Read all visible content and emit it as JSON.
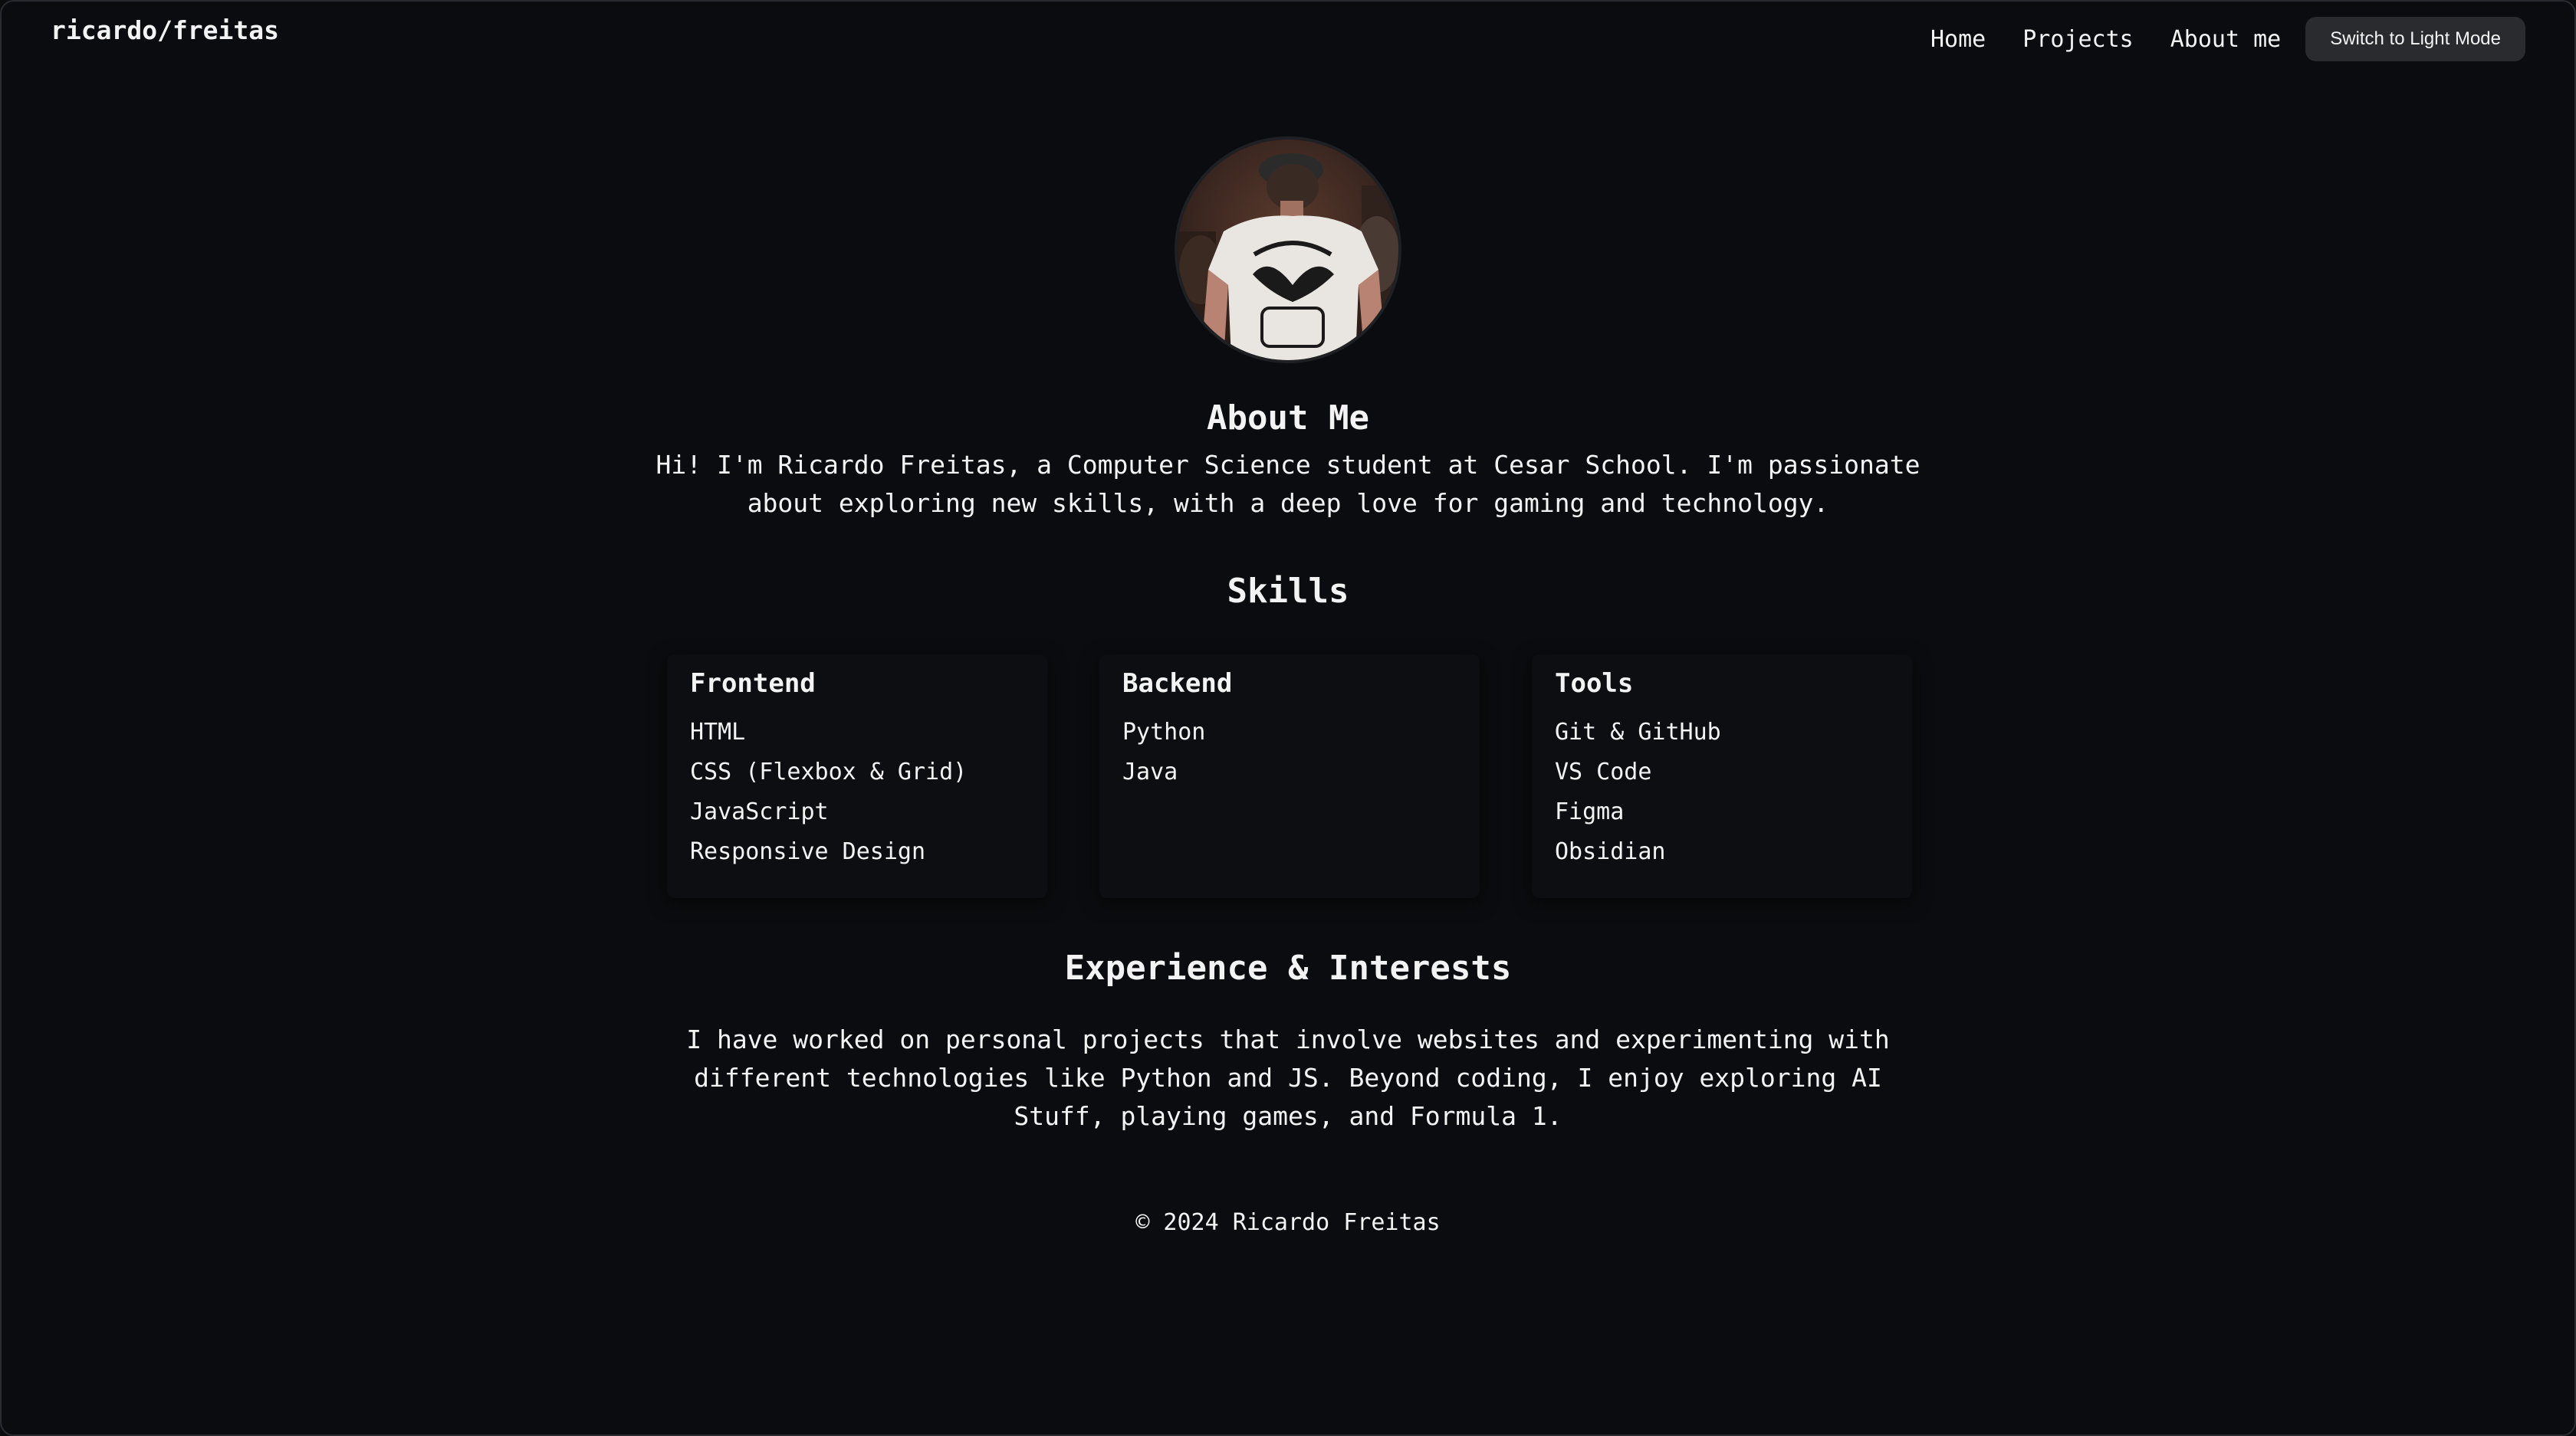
{
  "header": {
    "logo": "ricardo/freitas",
    "nav": [
      {
        "label": "Home"
      },
      {
        "label": "Projects"
      },
      {
        "label": "About me"
      }
    ],
    "theme_button": "Switch to Light Mode"
  },
  "about": {
    "title": "About Me",
    "text": "Hi! I'm Ricardo Freitas, a Computer Science student at Cesar School. I'm passionate about exploring new skills, with a deep love for gaming and technology."
  },
  "skills": {
    "title": "Skills",
    "categories": [
      {
        "name": "Frontend",
        "items": [
          "HTML",
          "CSS (Flexbox & Grid)",
          "JavaScript",
          "Responsive Design"
        ]
      },
      {
        "name": "Backend",
        "items": [
          "Python",
          "Java"
        ]
      },
      {
        "name": "Tools",
        "items": [
          "Git & GitHub",
          "VS Code",
          "Figma",
          "Obsidian"
        ]
      }
    ]
  },
  "experience": {
    "title": "Experience & Interests",
    "text": "I have worked on personal projects that involve websites and experimenting with different technologies like Python and JS. Beyond coding, I enjoy exploring AI Stuff, playing games, and Formula 1."
  },
  "footer": {
    "text": "© 2024 Ricardo Freitas"
  },
  "colors": {
    "background": "#0b0c0f",
    "text": "#f3f3f3",
    "button_bg": "#2a2b2f"
  }
}
